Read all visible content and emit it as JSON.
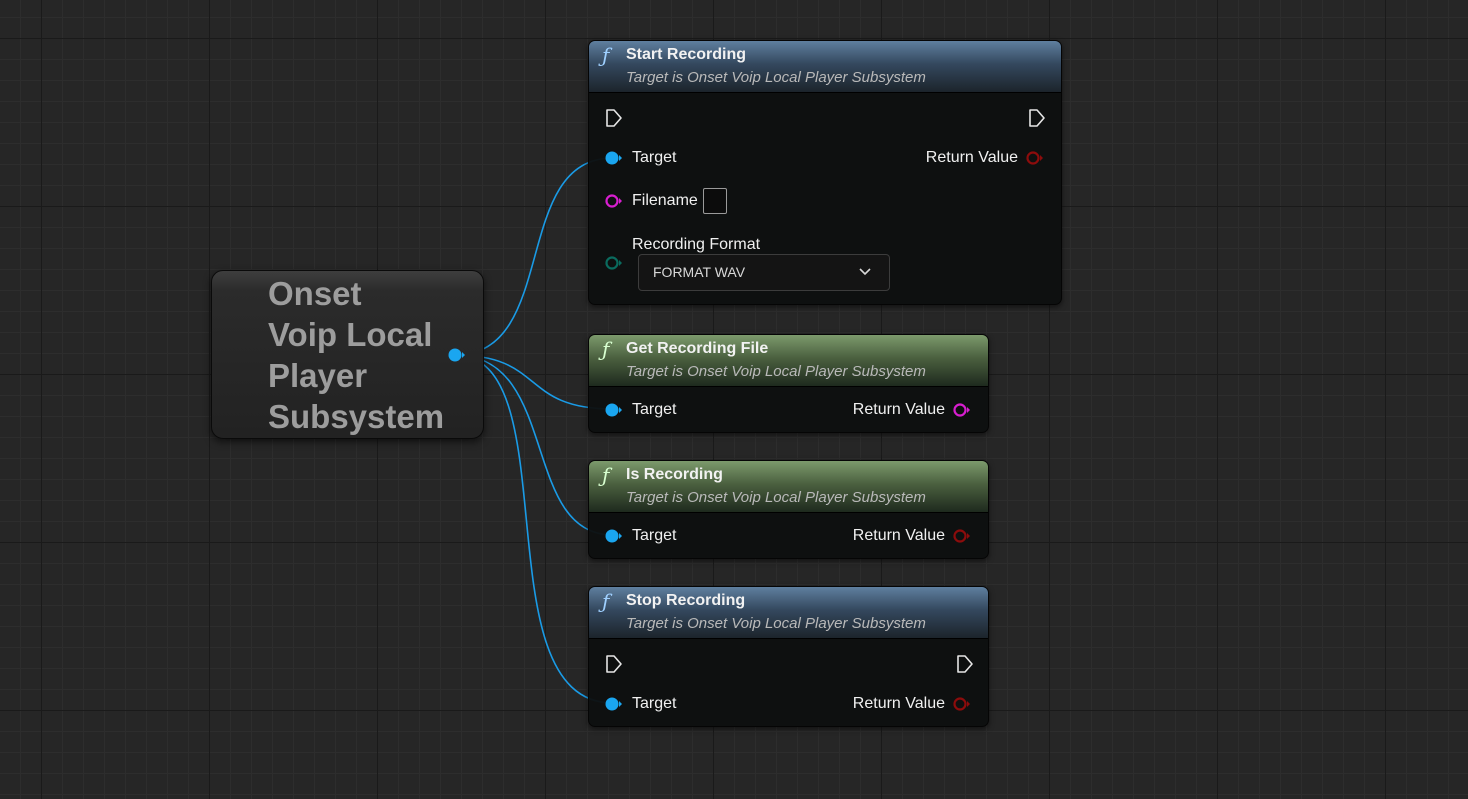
{
  "reference_node": {
    "title": "Onset Voip Local Player Subsystem"
  },
  "nodes": [
    {
      "title": "Start Recording",
      "subtitle": "Target is Onset Voip Local Player Subsystem",
      "target_label": "Target",
      "return_label": "Return Value",
      "filename_label": "Filename",
      "filename_value": "",
      "format_label": "Recording Format",
      "format_value": "FORMAT WAV"
    },
    {
      "title": "Get Recording File",
      "subtitle": "Target is Onset Voip Local Player Subsystem",
      "target_label": "Target",
      "return_label": "Return Value"
    },
    {
      "title": "Is Recording",
      "subtitle": "Target is Onset Voip Local Player Subsystem",
      "target_label": "Target",
      "return_label": "Return Value"
    },
    {
      "title": "Stop Recording",
      "subtitle": "Target is Onset Voip Local Player Subsystem",
      "target_label": "Target",
      "return_label": "Return Value"
    }
  ],
  "colors": {
    "object_pin": "#1aa6f0",
    "bool_pin": "#8c0c0c",
    "string_pin": "#d81ed0",
    "byte_pin": "#0a6b5e",
    "exec_pin": "#e6e6e6",
    "wire": "#1a9be6",
    "function_header_blue": "#5f7f9f",
    "pure_header_green": "#7c9a6c"
  },
  "icons": {
    "function": "function-f-icon",
    "exec": "exec-arrow-icon",
    "dropdown": "chevron-down-icon"
  }
}
